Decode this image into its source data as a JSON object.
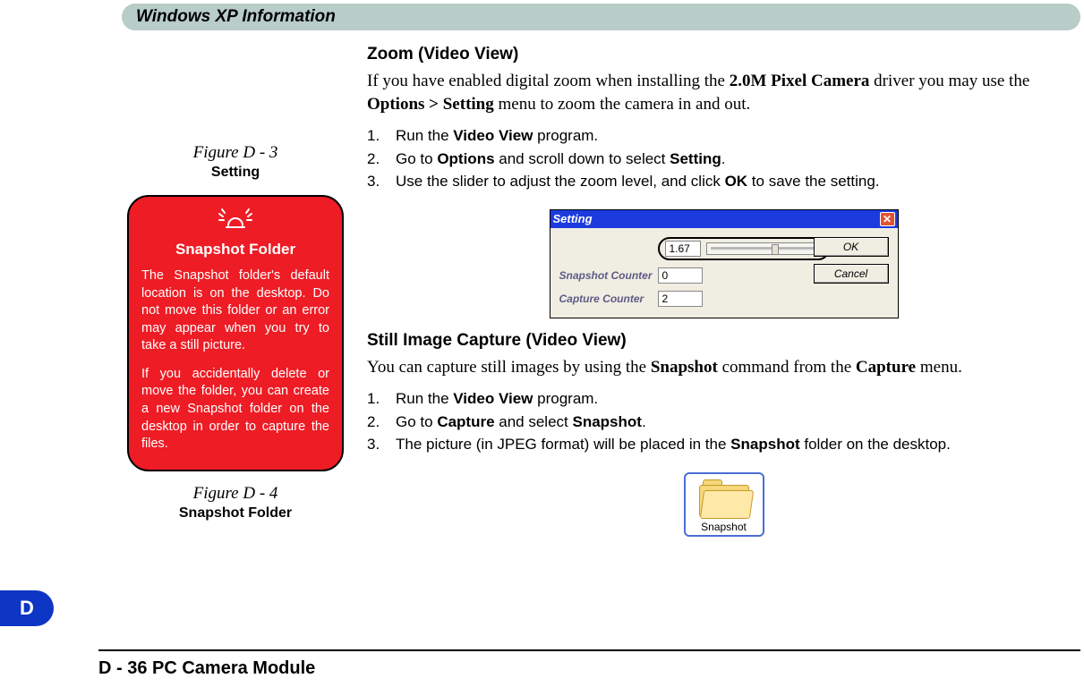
{
  "header": {
    "title": "Windows XP Information"
  },
  "tab": {
    "label": "D"
  },
  "main": {
    "zoom": {
      "heading": "Zoom (Video View)",
      "para_pre": "If you have enabled digital zoom when installing the ",
      "bold1": "2.0M Pixel Camera",
      "para_mid": " driver you may use the ",
      "bold2": "Options > Setting",
      "para_post": " menu to zoom the camera in and out.",
      "steps": {
        "n1": "1.",
        "s1a": "Run the ",
        "s1b": "Video View",
        "s1c": " program.",
        "n2": "2.",
        "s2a": "Go to ",
        "s2b": "Options",
        "s2c": " and scroll down to select ",
        "s2d": "Setting",
        "s2e": ".",
        "n3": "3.",
        "s3a": "Use the slider to adjust the zoom level, and click ",
        "s3b": "OK",
        "s3c": " to save the setting."
      }
    },
    "still": {
      "heading": "Still Image Capture (Video View)",
      "para_pre": "You can capture still images by using the ",
      "bold1": "Snapshot",
      "para_mid": " command from the ",
      "bold2": "Capture",
      "para_post": " menu.",
      "steps": {
        "n1": "1.",
        "s1a": "Run the ",
        "s1b": "Video View",
        "s1c": " program.",
        "n2": "2.",
        "s2a": "Go to ",
        "s2b": "Capture",
        "s2c": " and select ",
        "s2d": "Snapshot",
        "s2e": ".",
        "n3": "3.",
        "s3a": "The picture (in JPEG format) will be placed in the ",
        "s3b": "Snapshot",
        "s3c": " folder on the desktop."
      }
    },
    "dialog": {
      "title": "Setting",
      "zoom_value": "1.67",
      "snapshot_counter_label": "Snapshot Counter",
      "snapshot_counter_value": "0",
      "capture_counter_label": "Capture Counter",
      "capture_counter_value": "2",
      "ok": "OK",
      "cancel": "Cancel"
    },
    "snapshot_icon_label": "Snapshot"
  },
  "left": {
    "fig3_caption": "Figure D - 3",
    "fig3_sub": "Setting",
    "callout": {
      "title": "Snapshot Folder",
      "p1": "The Snapshot folder's default location is on the desktop. Do not move this folder or an error may appear when you try to take a still picture.",
      "p2": "If you accidentally delete or move the folder, you can create a new Snapshot folder on the desktop in order to capture the files."
    },
    "fig4_caption": "Figure D - 4",
    "fig4_sub": "Snapshot Folder"
  },
  "footer": {
    "text": "D - 36  PC Camera Module"
  }
}
